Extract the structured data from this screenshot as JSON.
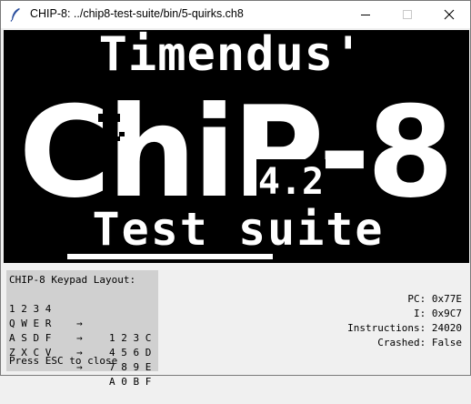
{
  "window": {
    "title": "CHIP-8: ../chip8-test-suite/bin/5-quirks.ch8"
  },
  "display": {
    "background": "#000000",
    "foreground": "#ffffff",
    "headline": "Timendus'",
    "logo": "ChiP-8",
    "version": "4.2",
    "subtitle": "Test suite"
  },
  "keypad": {
    "title": "CHIP-8 Keypad Layout:",
    "rows": [
      {
        "keys": "1 2 3 4",
        "arrow": "→",
        "chip": "1 2 3 C"
      },
      {
        "keys": "Q W E R",
        "arrow": "→",
        "chip": "4 5 6 D"
      },
      {
        "keys": "A S D F",
        "arrow": "→",
        "chip": "7 8 9 E"
      },
      {
        "keys": "Z X C V",
        "arrow": "→",
        "chip": "A 0 B F"
      }
    ],
    "hint": "Press ESC to close"
  },
  "status": {
    "pc_label": "PC:",
    "pc_value": "0x77E",
    "i_label": "I:",
    "i_value": "0x9C7",
    "instructions_label": "Instructions:",
    "instructions_value": "24020",
    "crashed_label": "Crashed:",
    "crashed_value": "False"
  }
}
